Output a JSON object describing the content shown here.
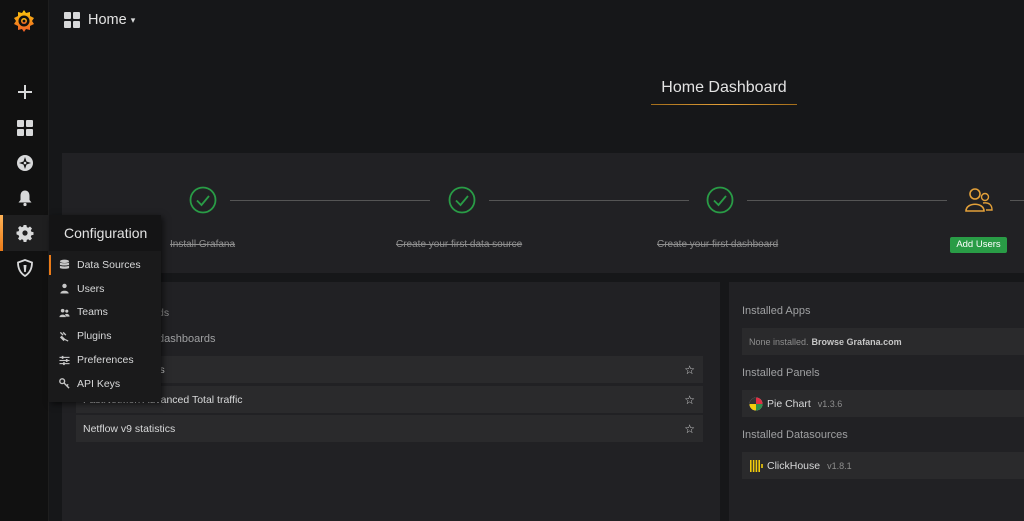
{
  "topnav": {
    "title": "Home",
    "caret": "▾"
  },
  "page": {
    "home_title": "Home Dashboard"
  },
  "sidebar": {
    "items": [
      {
        "name": "create",
        "icon": "plus-icon"
      },
      {
        "name": "dashboards",
        "icon": "dashboards-grid-icon"
      },
      {
        "name": "explore",
        "icon": "compass-icon"
      },
      {
        "name": "alerting",
        "icon": "bell-icon"
      },
      {
        "name": "configuration",
        "icon": "gear-icon",
        "active": true
      },
      {
        "name": "server-admin",
        "icon": "shield-icon"
      }
    ]
  },
  "flyout": {
    "title": "Configuration",
    "items": [
      {
        "label": "Data Sources",
        "icon": "database-icon",
        "active": true
      },
      {
        "label": "Users",
        "icon": "user-icon"
      },
      {
        "label": "Teams",
        "icon": "users-icon"
      },
      {
        "label": "Plugins",
        "icon": "plug-icon"
      },
      {
        "label": "Preferences",
        "icon": "sliders-icon"
      },
      {
        "label": "API Keys",
        "icon": "key-icon"
      }
    ]
  },
  "getting_started": {
    "steps": [
      {
        "label": "Install Grafana",
        "done": true
      },
      {
        "label": "Create your first data source",
        "done": true
      },
      {
        "label": "Create your first dashboard",
        "done": true
      }
    ],
    "add_users_button": "Add Users"
  },
  "left_panel": {
    "heading_starred": "ds",
    "heading_recent": "dashboards",
    "dashboards": [
      {
        "title": "tics"
      },
      {
        "title": "FastNetMon Advanced Total traffic"
      },
      {
        "title": "Netflow v9 statistics"
      }
    ]
  },
  "right_panel": {
    "installed_apps": {
      "heading": "Installed Apps",
      "none_text": "None installed.",
      "browse_text": "Browse Grafana.com"
    },
    "installed_panels": {
      "heading": "Installed Panels",
      "items": [
        {
          "name": "Pie Chart",
          "version": "v1.3.6",
          "icon": "pie-chart-plugin-icon"
        }
      ]
    },
    "installed_datasources": {
      "heading": "Installed Datasources",
      "items": [
        {
          "name": "ClickHouse",
          "version": "v1.8.1",
          "icon": "clickhouse-plugin-icon"
        }
      ]
    }
  },
  "colors": {
    "accent_orange": "#eb7b18",
    "success_green": "#299c46",
    "background": "#161719",
    "panel": "#212124"
  }
}
